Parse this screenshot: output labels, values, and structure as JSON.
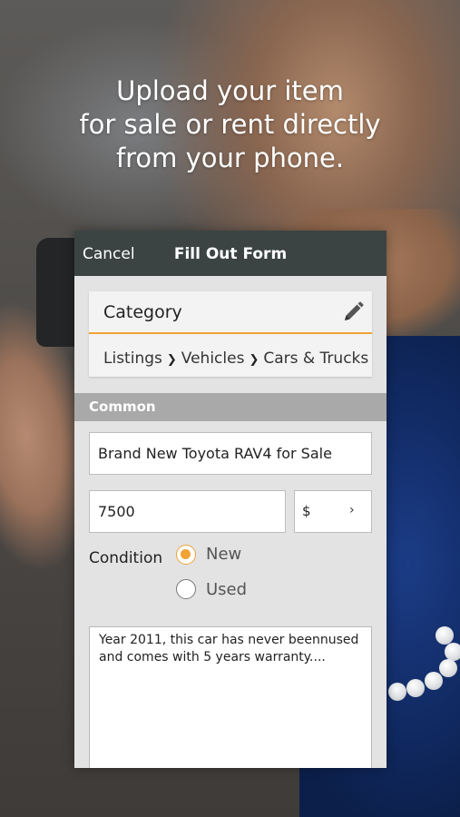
{
  "headline": {
    "line1": "Upload your item",
    "line2": "for sale or rent directly",
    "line3": "from your phone."
  },
  "navbar": {
    "cancel_label": "Cancel",
    "title": "Fill Out Form"
  },
  "category": {
    "label": "Category",
    "icon": "pencil-icon",
    "breadcrumb": [
      "Listings",
      "Vehicles",
      "Cars & Trucks"
    ],
    "separator": "❯"
  },
  "section": {
    "title": "Common"
  },
  "form": {
    "title_value": "Brand New Toyota RAV4 for Sale",
    "price_value": "7500",
    "currency_value": "$",
    "currency_chevron": "›",
    "condition_label": "Condition",
    "condition_options": [
      {
        "label": "New",
        "selected": true
      },
      {
        "label": "Used",
        "selected": false
      }
    ],
    "description_line1": "Year 2011, this car has never beennused",
    "description_line2": "and comes with 5 years warranty...."
  },
  "colors": {
    "accent": "#f0a235",
    "navbar": "#3b4443",
    "section": "#a9a9a9"
  }
}
